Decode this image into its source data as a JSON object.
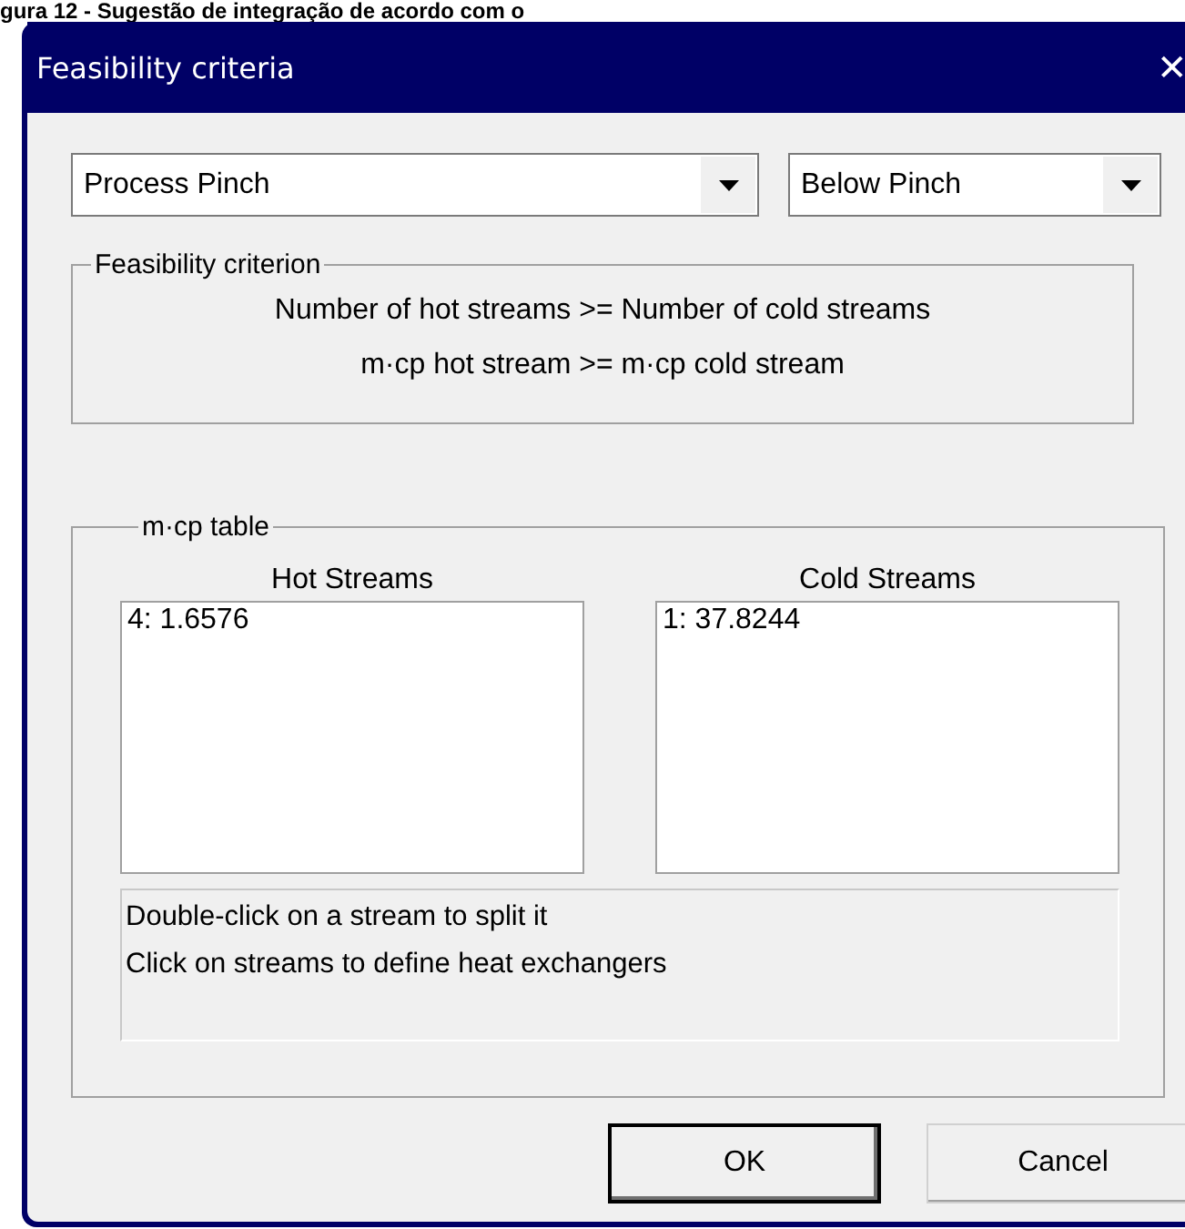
{
  "caption": "gura 12 - Sugestão de integração de acordo com o",
  "window": {
    "title": "Feasibility criteria",
    "close": "✕"
  },
  "dropdowns": [
    {
      "value": "Process Pinch"
    },
    {
      "value": "Below Pinch"
    }
  ],
  "criterion_group": {
    "title": "Feasibility criterion",
    "lines": [
      "Number of hot streams >= Number of cold streams",
      "m·cp hot stream >= m·cp cold stream"
    ]
  },
  "mcp_table": {
    "title": "m·cp table",
    "lists": [
      {
        "heading": "Hot Streams",
        "items": [
          "4: 1.6576"
        ]
      },
      {
        "heading": "Cold Streams",
        "items": [
          "1: 37.8244"
        ]
      }
    ],
    "hint_lines": [
      "Double-click on a stream to split it",
      "Click on streams to define heat exchangers"
    ]
  },
  "buttons": [
    {
      "label": "OK",
      "default": true
    },
    {
      "label": "Cancel",
      "default": false
    }
  ]
}
